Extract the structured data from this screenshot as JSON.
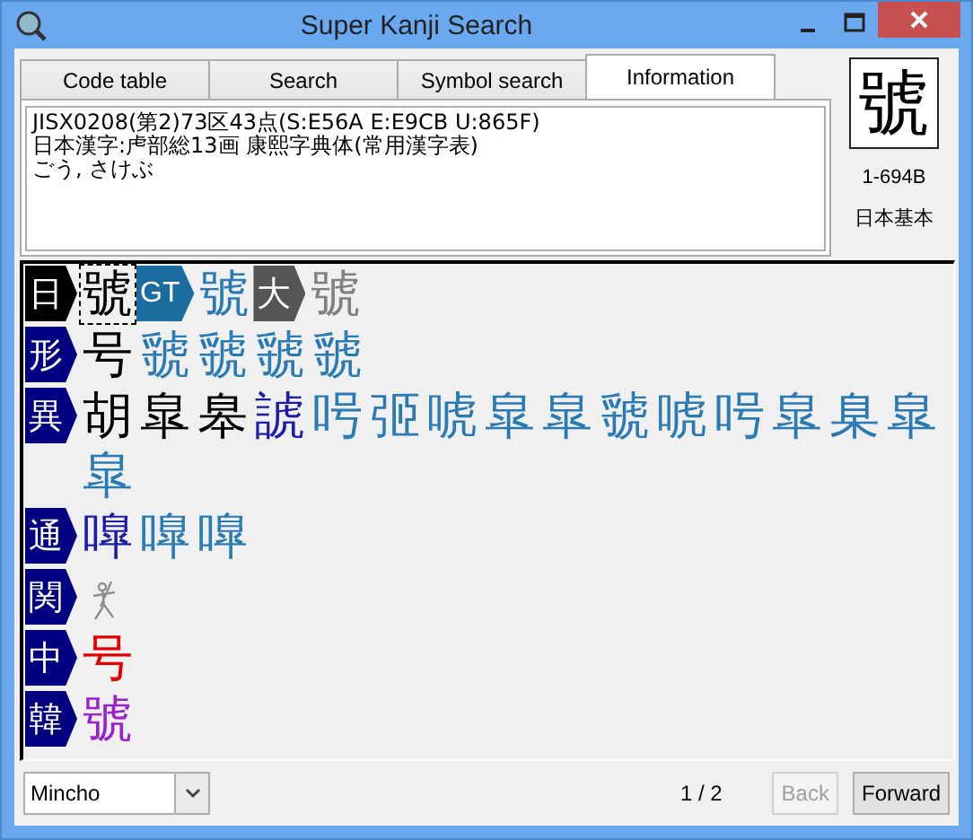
{
  "window": {
    "title": "Super Kanji Search"
  },
  "tabs": [
    {
      "label": "Code table",
      "selected": false
    },
    {
      "label": "Search",
      "selected": false
    },
    {
      "label": "Symbol search",
      "selected": false
    },
    {
      "label": "Information",
      "selected": true
    }
  ],
  "info": {
    "lines": [
      "JISX0208(第2)73区43点(S:E56A E:E9CB U:865F)",
      "日本漢字:虍部総13画 康熙字典体(常用漢字表)",
      "ごう, さけぶ"
    ]
  },
  "preview": {
    "glyph": "號",
    "code": "1-694B",
    "label": "日本基本"
  },
  "rows": [
    {
      "items": [
        {
          "kind": "badge",
          "text": "日",
          "color": "#000000"
        },
        {
          "kind": "char",
          "text": "號",
          "color": "#000000",
          "selected": true
        },
        {
          "kind": "badge",
          "text": "GT",
          "color": "#1a6d9e"
        },
        {
          "kind": "char",
          "text": "號",
          "color": "#2a7ab4",
          "selected": false
        },
        {
          "kind": "badge",
          "text": "大",
          "color": "#555555"
        },
        {
          "kind": "char",
          "text": "號",
          "color": "#808080",
          "selected": false
        }
      ]
    },
    {
      "items": [
        {
          "kind": "badge",
          "text": "形",
          "color": "#000080"
        },
        {
          "kind": "char",
          "text": "号",
          "color": "#000000",
          "selected": false
        },
        {
          "kind": "char",
          "text": "虢",
          "color": "#2a7ab4",
          "selected": false
        },
        {
          "kind": "char",
          "text": "虢",
          "color": "#2a7ab4",
          "selected": false
        },
        {
          "kind": "char",
          "text": "虢",
          "color": "#2a7ab4",
          "selected": false
        },
        {
          "kind": "char",
          "text": "虢",
          "color": "#2a7ab4",
          "selected": false
        }
      ]
    },
    {
      "items": [
        {
          "kind": "badge",
          "text": "異",
          "color": "#000080"
        },
        {
          "kind": "char",
          "text": "胡",
          "color": "#000000",
          "selected": false
        },
        {
          "kind": "char",
          "text": "皐",
          "color": "#000000",
          "selected": false
        },
        {
          "kind": "char",
          "text": "皋",
          "color": "#000000",
          "selected": false
        },
        {
          "kind": "char",
          "text": "諕",
          "color": "#1c1ca8",
          "selected": false
        },
        {
          "kind": "char",
          "text": "呺",
          "color": "#2a7ab4",
          "selected": false
        },
        {
          "kind": "char",
          "text": "弬",
          "color": "#2a7ab4",
          "selected": false
        },
        {
          "kind": "char",
          "text": "唬",
          "color": "#2a7ab4",
          "selected": false
        },
        {
          "kind": "char",
          "text": "皐",
          "color": "#2a7ab4",
          "selected": false
        },
        {
          "kind": "char",
          "text": "皐",
          "color": "#2a7ab4",
          "selected": false
        },
        {
          "kind": "char",
          "text": "虢",
          "color": "#2a7ab4",
          "selected": false
        },
        {
          "kind": "char",
          "text": "唬",
          "color": "#2a7ab4",
          "selected": false
        },
        {
          "kind": "char",
          "text": "呺",
          "color": "#2a7ab4",
          "selected": false
        },
        {
          "kind": "char",
          "text": "皐",
          "color": "#2a7ab4",
          "selected": false
        },
        {
          "kind": "char",
          "text": "臬",
          "color": "#2a7ab4",
          "selected": false
        },
        {
          "kind": "char",
          "text": "皐",
          "color": "#2a7ab4",
          "selected": false
        },
        {
          "kind": "char",
          "text": "皐",
          "color": "#2a7ab4",
          "selected": false
        }
      ]
    },
    {
      "items": [
        {
          "kind": "badge",
          "text": "通",
          "color": "#000080"
        },
        {
          "kind": "char",
          "text": "嘷",
          "color": "#1c1ca8",
          "selected": false
        },
        {
          "kind": "char",
          "text": "嘷",
          "color": "#2a7ab4",
          "selected": false
        },
        {
          "kind": "char",
          "text": "嘷",
          "color": "#2a7ab4",
          "selected": false
        }
      ]
    },
    {
      "items": [
        {
          "kind": "badge",
          "text": "関",
          "color": "#000080"
        },
        {
          "kind": "image",
          "color": "#909090",
          "selected": false
        }
      ]
    },
    {
      "items": [
        {
          "kind": "badge",
          "text": "中",
          "color": "#000080"
        },
        {
          "kind": "char",
          "text": "号",
          "color": "#e00000",
          "selected": false
        }
      ]
    },
    {
      "items": [
        {
          "kind": "badge",
          "text": "韓",
          "color": "#000080"
        },
        {
          "kind": "char",
          "text": "號",
          "color": "#9a22c8",
          "selected": false
        }
      ]
    }
  ],
  "font_select": {
    "value": "Mincho"
  },
  "pager": {
    "page": "1 / 2"
  },
  "buttons": [
    {
      "label": "Back",
      "disabled": true
    },
    {
      "label": "Forward",
      "disabled": false
    }
  ]
}
